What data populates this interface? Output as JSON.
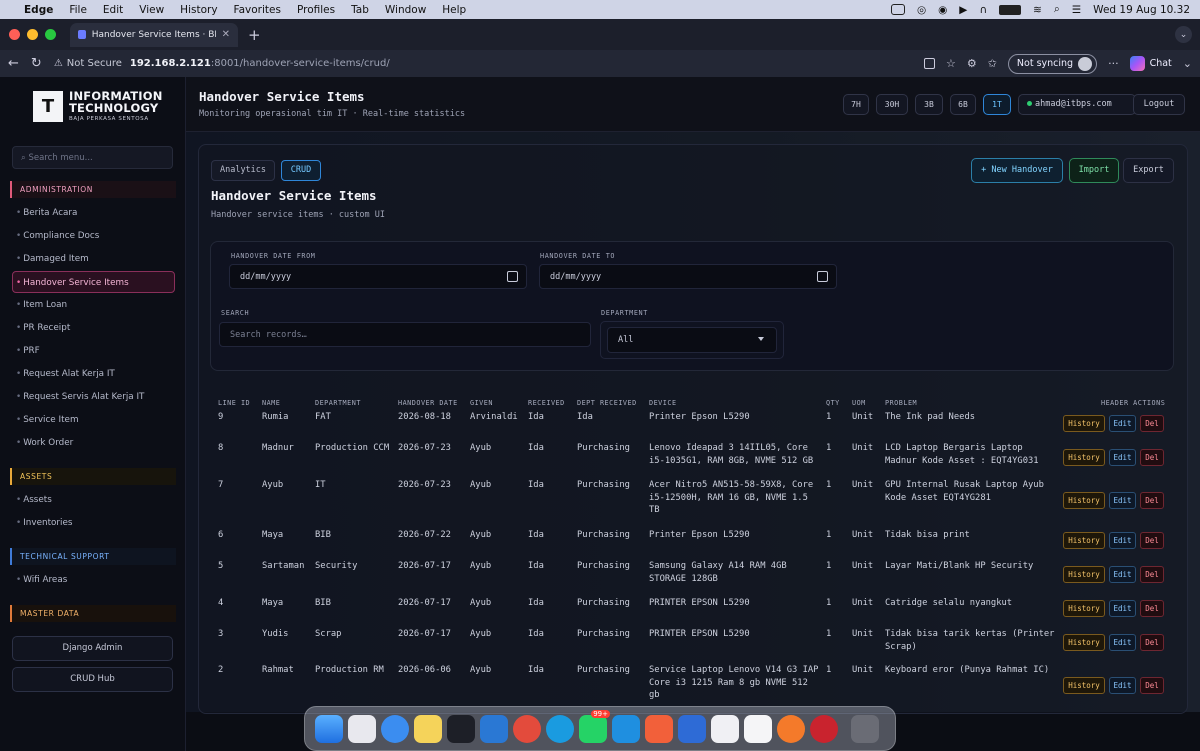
{
  "menubar": {
    "app": "Edge",
    "items": [
      "File",
      "Edit",
      "View",
      "History",
      "Favorites",
      "Profiles",
      "Tab",
      "Window",
      "Help"
    ],
    "clock": "Wed 19 Aug  10.32"
  },
  "browser": {
    "tab_title": "Handover Service Items · BPS IT",
    "security": "Not Secure",
    "url_host": "192.168.2.121",
    "url_path": ":8001/handover-service-items/crud/",
    "sync_label": "Not syncing",
    "chat_label": "Chat",
    "more": "···"
  },
  "brand": {
    "line1": "INFORMATION",
    "line2": "TECHNOLOGY",
    "line3": "BAJA PERKASA SENTOSA"
  },
  "sidebar": {
    "search_placeholder": "Search menu...",
    "sections": {
      "admin": "ADMINISTRATION",
      "assets": "ASSETS",
      "tech": "TECHNICAL SUPPORT",
      "master": "MASTER DATA"
    },
    "admin_items": [
      "Berita Acara",
      "Compliance Docs",
      "Damaged Item",
      "Handover Service Items",
      "Item Loan",
      "PR Receipt",
      "PRF",
      "Request Alat Kerja IT",
      "Request Servis Alat Kerja IT",
      "Service Item",
      "Work Order"
    ],
    "asset_items": [
      "Assets",
      "Inventories"
    ],
    "tech_items": [
      "Wifi Areas"
    ],
    "django_admin": "Django Admin",
    "crud_hub": "CRUD Hub"
  },
  "header": {
    "title": "Handover Service Items",
    "subtitle": "Monitoring operasional tim IT · Real-time statistics",
    "ranges": [
      "7H",
      "30H",
      "3B",
      "6B",
      "1T"
    ],
    "active_range": "1T",
    "email": "ahmad@itbps.com",
    "logout": "Logout"
  },
  "page": {
    "tab_analytics": "Analytics",
    "tab_crud": "CRUD",
    "title": "Handover Service Items",
    "subtitle": "Handover service items · custom UI",
    "new_btn": "+ New Handover",
    "import_btn": "Import",
    "export_btn": "Export"
  },
  "filters": {
    "date_from_label": "HANDOVER DATE FROM",
    "date_to_label": "HANDOVER DATE TO",
    "date_placeholder": "dd/mm/yyyy",
    "search_label": "SEARCH",
    "search_placeholder": "Search records…",
    "dept_label": "DEPARTMENT",
    "dept_value": "All"
  },
  "table": {
    "columns": [
      "LINE ID",
      "NAME",
      "DEPARTMENT",
      "HANDOVER DATE",
      "GIVEN",
      "RECEIVED",
      "DEPT RECEIVED",
      "DEVICE",
      "QTY",
      "UOM",
      "PROBLEM",
      "HEADER ACTIONS"
    ],
    "action_labels": {
      "history": "History",
      "edit": "Edit",
      "del": "Del"
    },
    "rows": [
      {
        "id": "9",
        "name": "Rumia",
        "dept": "FAT",
        "date": "2026-08-18",
        "given": "Arvinaldi",
        "received": "Ida",
        "dept_received": "Ida",
        "device": [
          "Printer Epson L5290"
        ],
        "qty": "1",
        "uom": "Unit",
        "problem": [
          "The Ink pad Needs"
        ]
      },
      {
        "id": "8",
        "name": "Madnur",
        "dept": "Production CCM",
        "date": "2026-07-23",
        "given": "Ayub",
        "received": "Ida",
        "dept_received": "Purchasing",
        "device": [
          "Lenovo Ideapad 3 14IIL05, Core",
          "i5-1035G1, RAM 8GB, NVME 512 GB"
        ],
        "qty": "1",
        "uom": "Unit",
        "problem": [
          "LCD Laptop Bergaris Laptop",
          "Madnur Kode Asset : EQT4YG031"
        ]
      },
      {
        "id": "7",
        "name": "Ayub",
        "dept": "IT",
        "date": "2026-07-23",
        "given": "Ayub",
        "received": "Ida",
        "dept_received": "Purchasing",
        "device": [
          "Acer Nitro5 AN515-58-59X8, Core",
          "i5-12500H, RAM 16 GB, NVME 1.5",
          "TB"
        ],
        "qty": "1",
        "uom": "Unit",
        "problem": [
          "GPU Internal Rusak Laptop Ayub",
          "Kode Asset EQT4YG281"
        ]
      },
      {
        "id": "6",
        "name": "Maya",
        "dept": "BIB",
        "date": "2026-07-22",
        "given": "Ayub",
        "received": "Ida",
        "dept_received": "Purchasing",
        "device": [
          "Printer Epson L5290"
        ],
        "qty": "1",
        "uom": "Unit",
        "problem": [
          "Tidak bisa print"
        ]
      },
      {
        "id": "5",
        "name": "Sartaman",
        "dept": "Security",
        "date": "2026-07-17",
        "given": "Ayub",
        "received": "Ida",
        "dept_received": "Purchasing",
        "device": [
          "Samsung Galaxy A14 RAM 4GB",
          "STORAGE 128GB"
        ],
        "qty": "1",
        "uom": "Unit",
        "problem": [
          "Layar Mati/Blank HP Security"
        ]
      },
      {
        "id": "4",
        "name": "Maya",
        "dept": "BIB",
        "date": "2026-07-17",
        "given": "Ayub",
        "received": "Ida",
        "dept_received": "Purchasing",
        "device": [
          "PRINTER EPSON L5290"
        ],
        "qty": "1",
        "uom": "Unit",
        "problem": [
          "Catridge selalu nyangkut"
        ]
      },
      {
        "id": "3",
        "name": "Yudis",
        "dept": "Scrap",
        "date": "2026-07-17",
        "given": "Ayub",
        "received": "Ida",
        "dept_received": "Purchasing",
        "device": [
          "PRINTER EPSON L5290"
        ],
        "qty": "1",
        "uom": "Unit",
        "problem": [
          "Tidak bisa tarik kertas (Printer",
          "Scrap)"
        ]
      },
      {
        "id": "2",
        "name": "Rahmat",
        "dept": "Production RM",
        "date": "2026-06-06",
        "given": "Ayub",
        "received": "Ida",
        "dept_received": "Purchasing",
        "device": [
          "Service Laptop Lenovo V14 G3 IAP",
          "Core i3 1215 Ram 8 gb NVME 512",
          "gb"
        ],
        "qty": "1",
        "uom": "Unit",
        "problem": [
          "Keyboard eror (Punya Rahmat IC)"
        ]
      }
    ]
  },
  "dock": {
    "badge": "99+"
  },
  "colors": {
    "accent": "#2f86d8",
    "active_nav": "#f06aa6",
    "history": "#f5c46a",
    "edit": "#8cc8ff",
    "delete": "#ff8b96"
  }
}
